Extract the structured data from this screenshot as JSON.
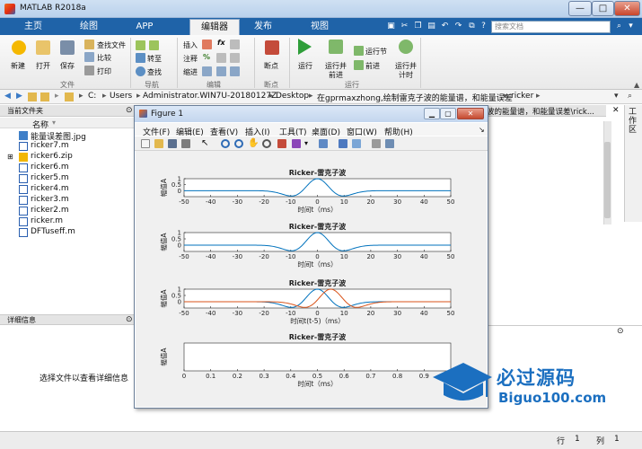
{
  "window": {
    "title": "MATLAB R2018a",
    "min": "—",
    "max": "□",
    "close": "✕"
  },
  "tabs": [
    {
      "label": "主页"
    },
    {
      "label": "绘图"
    },
    {
      "label": "APP"
    },
    {
      "label": "编辑器"
    },
    {
      "label": "发布"
    },
    {
      "label": "视图"
    }
  ],
  "search": {
    "placeholder": "搜索文档"
  },
  "ribbon": {
    "file": {
      "new": "新建",
      "open": "打开",
      "save": "保存",
      "find_files": "查找文件",
      "compare": "比较",
      "print": "打印",
      "section": "文件"
    },
    "nav": {
      "goto": "转至",
      "find": "查找",
      "section": "导航"
    },
    "edit": {
      "insert": "插入",
      "comment": "注释",
      "indent": "缩进",
      "section": "编辑"
    },
    "breakpoints": {
      "label": "断点",
      "section": "断点"
    },
    "run": {
      "run": "运行",
      "run_advance_1": "运行并",
      "run_advance_2": "前进",
      "run_section": "运行节",
      "advance": "前进",
      "run_time_1": "运行并",
      "run_time_2": "计时",
      "section": "运行"
    }
  },
  "address": {
    "segments": [
      "C:",
      "Users",
      "Administrator.WIN7U-20180127Z",
      "Desktop",
      "在gprmaxzhong,绘制雷克子波的能量谱，和能量误差",
      "ricker"
    ]
  },
  "current_folder": {
    "header": "当前文件夹",
    "column": "名称",
    "files": [
      {
        "name": "能量误差图.jpg",
        "type": "image"
      },
      {
        "name": "ricker7.m",
        "type": "m"
      },
      {
        "name": "ricker6.zip",
        "type": "zip"
      },
      {
        "name": "ricker6.m",
        "type": "m"
      },
      {
        "name": "ricker5.m",
        "type": "m"
      },
      {
        "name": "ricker4.m",
        "type": "m"
      },
      {
        "name": "ricker3.m",
        "type": "m"
      },
      {
        "name": "ricker2.m",
        "type": "m"
      },
      {
        "name": "ricker.m",
        "type": "m"
      },
      {
        "name": "DFTuseff.m",
        "type": "m"
      }
    ]
  },
  "details": {
    "header": "详细信息",
    "hint": "选择文件以查看详细信息"
  },
  "right_panel": {
    "path": "波的能量谱，和能量误差\\rick...",
    "workspace_label": "工作区"
  },
  "status": {
    "line_label": "行",
    "line": "1",
    "col_label": "列",
    "col": "1"
  },
  "figure": {
    "title": "Figure 1",
    "menus": [
      "文件(F)",
      "编辑(E)",
      "查看(V)",
      "插入(I)",
      "工具(T)",
      "桌面(D)",
      "窗口(W)",
      "帮助(H)"
    ]
  },
  "chart_data": [
    {
      "type": "line",
      "title": "Ricker-雷克子波",
      "xlabel": "时间t（ms）",
      "ylabel": "幅值A",
      "xlim": [
        -50,
        50
      ],
      "ylim": [
        -0.5,
        1
      ],
      "xticks": [
        -50,
        -40,
        -30,
        -20,
        -10,
        0,
        10,
        20,
        30,
        40,
        50
      ],
      "yticks": [
        1,
        0.5,
        0
      ],
      "series": [
        {
          "color": "#0072bd",
          "shift": 0
        }
      ]
    },
    {
      "type": "line",
      "title": "Ricker-雷克子波",
      "xlabel": "时间t（ms）",
      "ylabel": "幅值A",
      "xlim": [
        -50,
        50
      ],
      "ylim": [
        -0.5,
        1
      ],
      "xticks": [
        -50,
        -40,
        -30,
        -20,
        -10,
        0,
        10,
        20,
        30,
        40,
        50
      ],
      "yticks": [
        1,
        0.5,
        0
      ],
      "series": [
        {
          "color": "#0072bd",
          "shift": 0
        }
      ]
    },
    {
      "type": "line",
      "title": "Ricker-雷克子波",
      "xlabel": "时间t(t-5)（ms）",
      "ylabel": "幅值A",
      "xlim": [
        -50,
        50
      ],
      "ylim": [
        -0.5,
        1
      ],
      "xticks": [
        -50,
        -40,
        -30,
        -20,
        -10,
        0,
        10,
        20,
        30,
        40,
        50
      ],
      "yticks": [
        1,
        0.5,
        0
      ],
      "series": [
        {
          "color": "#0072bd",
          "shift": 0
        },
        {
          "color": "#d95319",
          "shift": 5
        }
      ]
    },
    {
      "type": "line",
      "title": "Ricker-雷克子波",
      "xlabel": "时间t（ms）",
      "ylabel": "幅值A",
      "xlim": [
        0,
        1
      ],
      "ylim": [
        0,
        1
      ],
      "xticks": [
        0,
        0.1,
        0.2,
        0.3,
        0.4,
        0.5,
        0.6,
        0.7,
        0.8,
        0.9,
        1
      ],
      "yticks": [],
      "series": []
    }
  ],
  "watermark": {
    "title": "必过源码",
    "url": "Biguo100.com"
  }
}
